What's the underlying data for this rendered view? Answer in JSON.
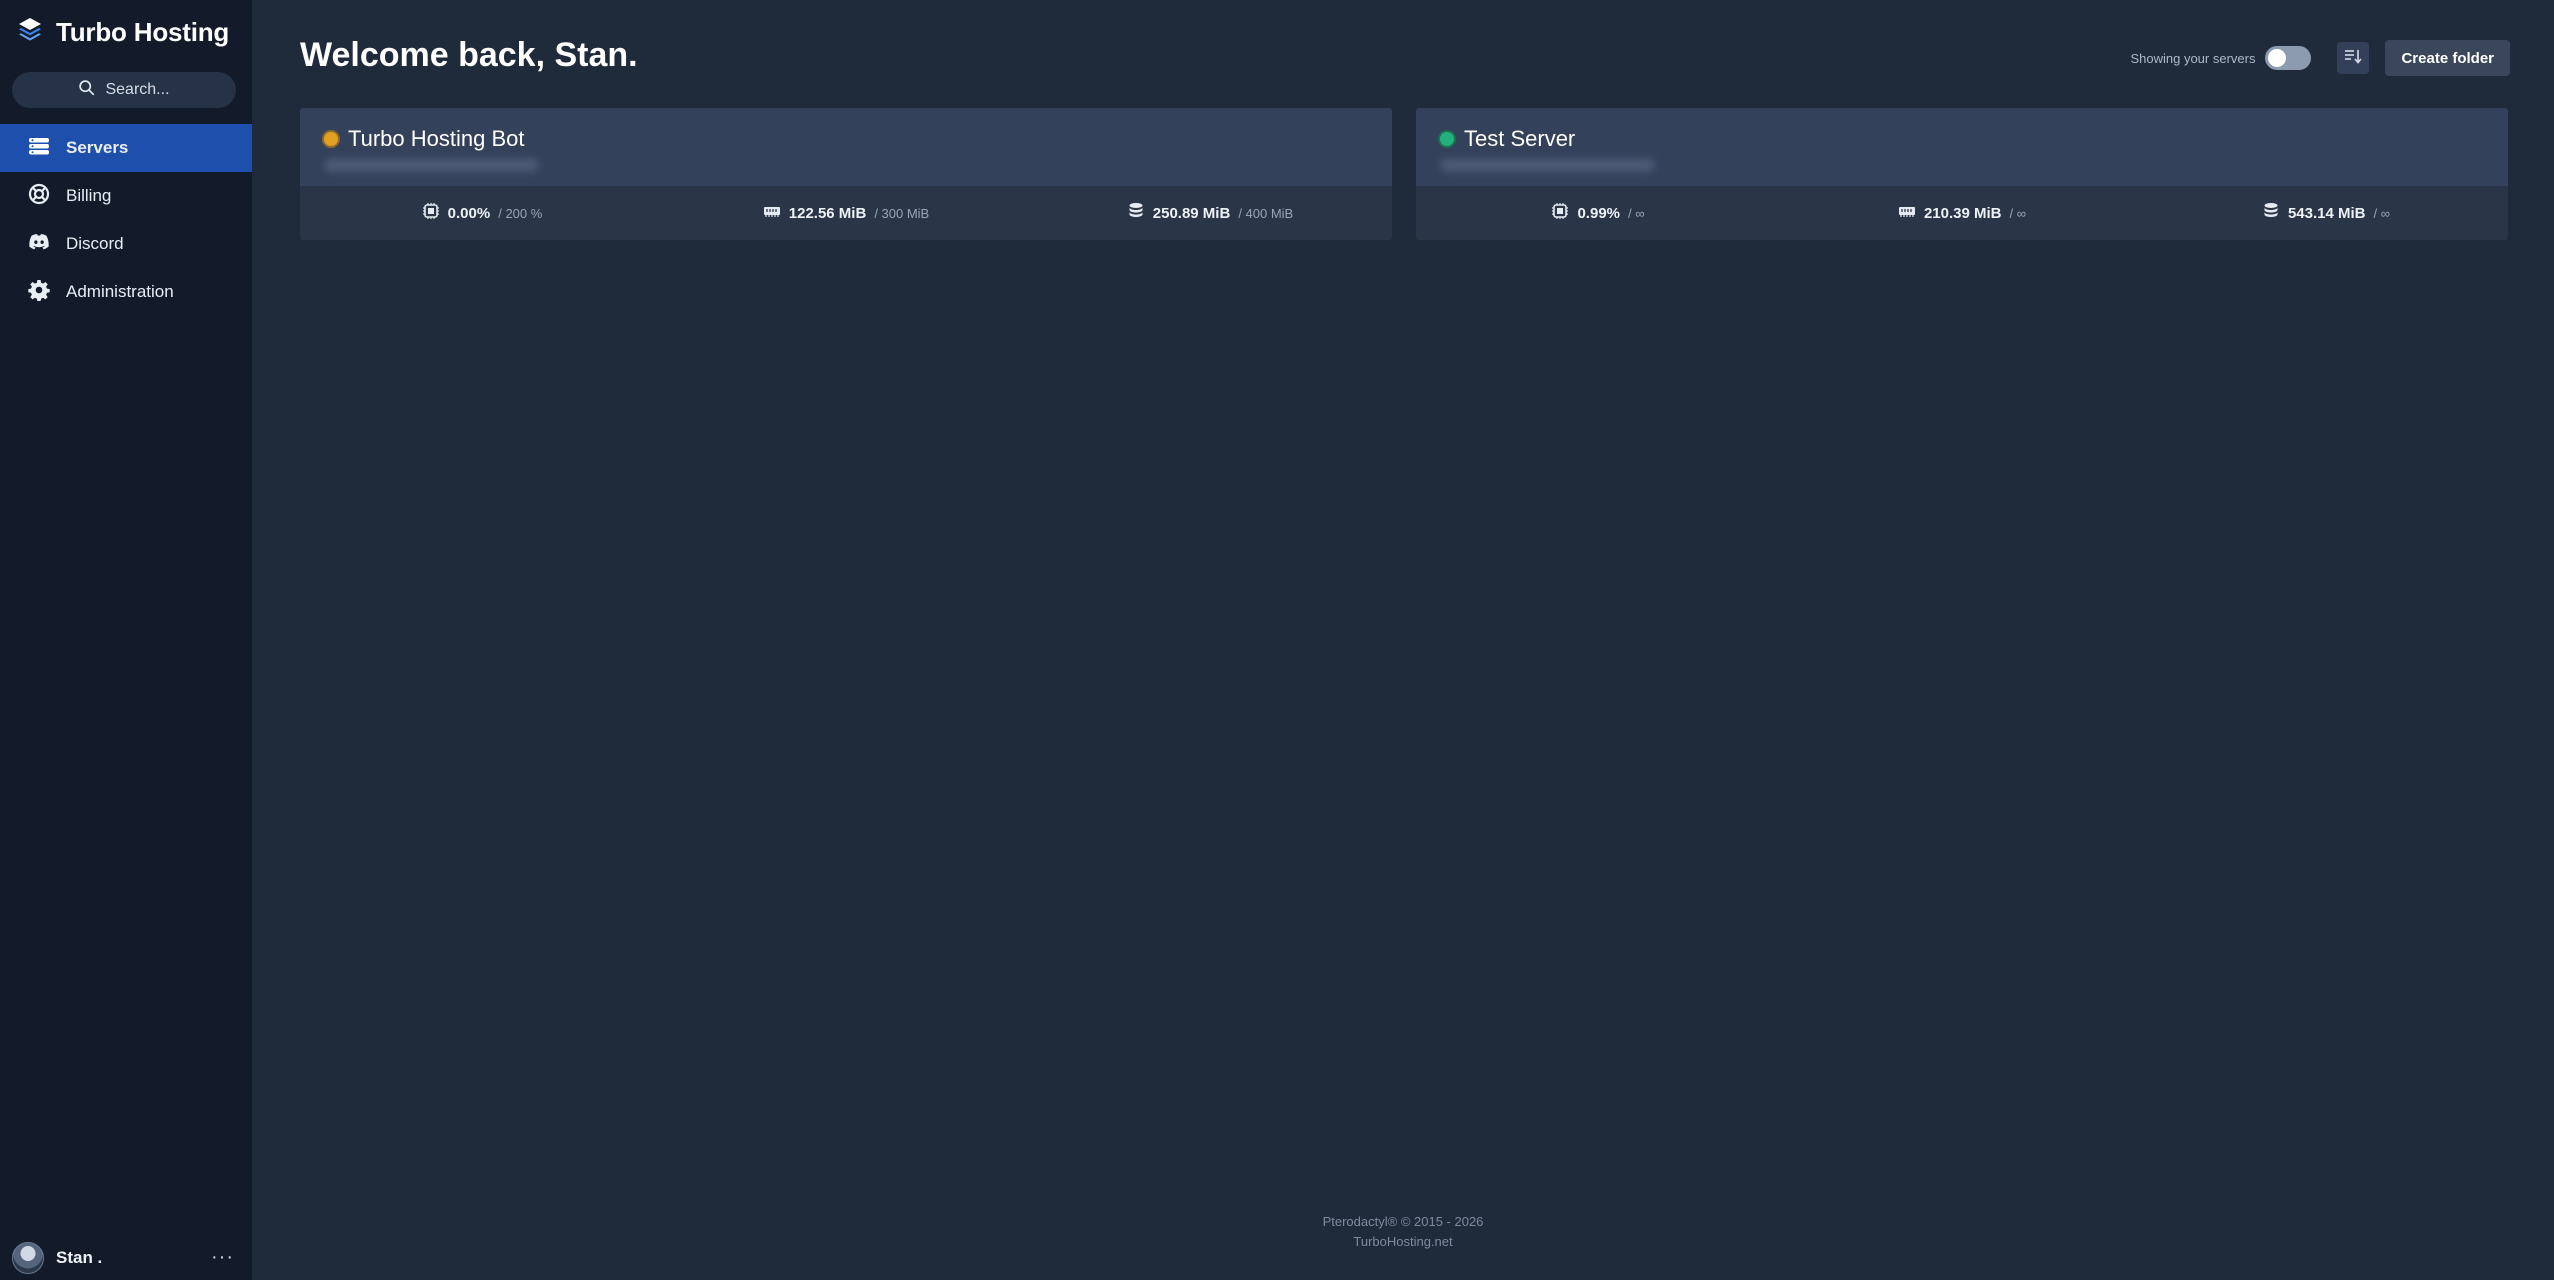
{
  "brand": {
    "name": "Turbo Hosting",
    "icon": "stack-icon"
  },
  "search": {
    "placeholder": "Search..."
  },
  "nav": [
    {
      "label": "Servers",
      "icon": "servers-icon",
      "active": true
    },
    {
      "label": "Billing",
      "icon": "billing-icon",
      "active": false
    },
    {
      "label": "Discord",
      "icon": "discord-icon",
      "active": false
    },
    {
      "label": "Administration",
      "icon": "gear-icon",
      "active": false
    }
  ],
  "user": {
    "name": "Stan .",
    "more": "···"
  },
  "main": {
    "welcome": "Welcome back, Stan.",
    "toggle_label": "Showing your servers",
    "toggle_on": false,
    "create_folder": "Create folder"
  },
  "servers": [
    {
      "name": "Turbo Hosting Bot",
      "status": "starting",
      "status_color": "#e0a021",
      "cpu": "0.00%",
      "cpu_limit": "/ 200 %",
      "memory": "122.56 MiB",
      "memory_limit": "/ 300 MiB",
      "disk": "250.89 MiB",
      "disk_limit": "/ 400 MiB"
    },
    {
      "name": "Test Server",
      "status": "running",
      "status_color": "#23b07c",
      "cpu": "0.99%",
      "cpu_limit": "/ ∞",
      "memory": "210.39 MiB",
      "memory_limit": "/ ∞",
      "disk": "543.14 MiB",
      "disk_limit": "/ ∞"
    }
  ],
  "footer": {
    "line1": "Pterodactyl® © 2015 - 2026",
    "line2": "TurboHosting.net"
  },
  "colors": {
    "background": "#1f2a3b",
    "sidebar": "#131b2b",
    "accent": "#1f4fad"
  }
}
